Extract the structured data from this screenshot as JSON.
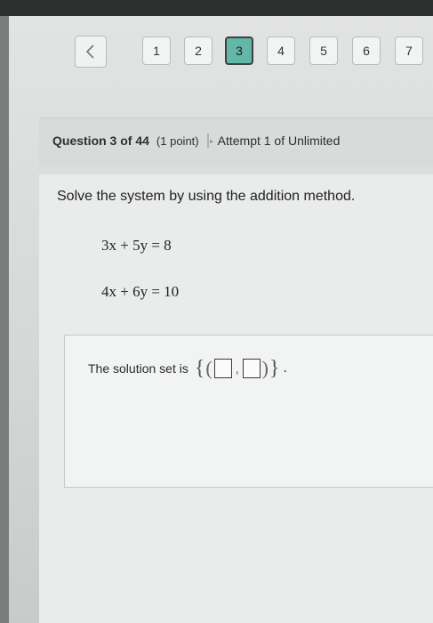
{
  "pager": {
    "prev_label": "<",
    "pages": [
      "1",
      "2",
      "3",
      "4",
      "5",
      "6",
      "7"
    ],
    "current_page": "3"
  },
  "question_header": {
    "number_text": "Question 3 of 44",
    "points_text": "(1 point)",
    "attempt_text": "Attempt 1 of Unlimited"
  },
  "problem": {
    "instruction": "Solve the system by using the addition method.",
    "equation1": "3x + 5y = 8",
    "equation2": "4x + 6y = 10"
  },
  "answer": {
    "prompt": "The solution set is",
    "x_value": "",
    "y_value": ""
  },
  "colors": {
    "current_page_bg": "#62b7a8",
    "screen_bg": "#e2e3e3"
  }
}
